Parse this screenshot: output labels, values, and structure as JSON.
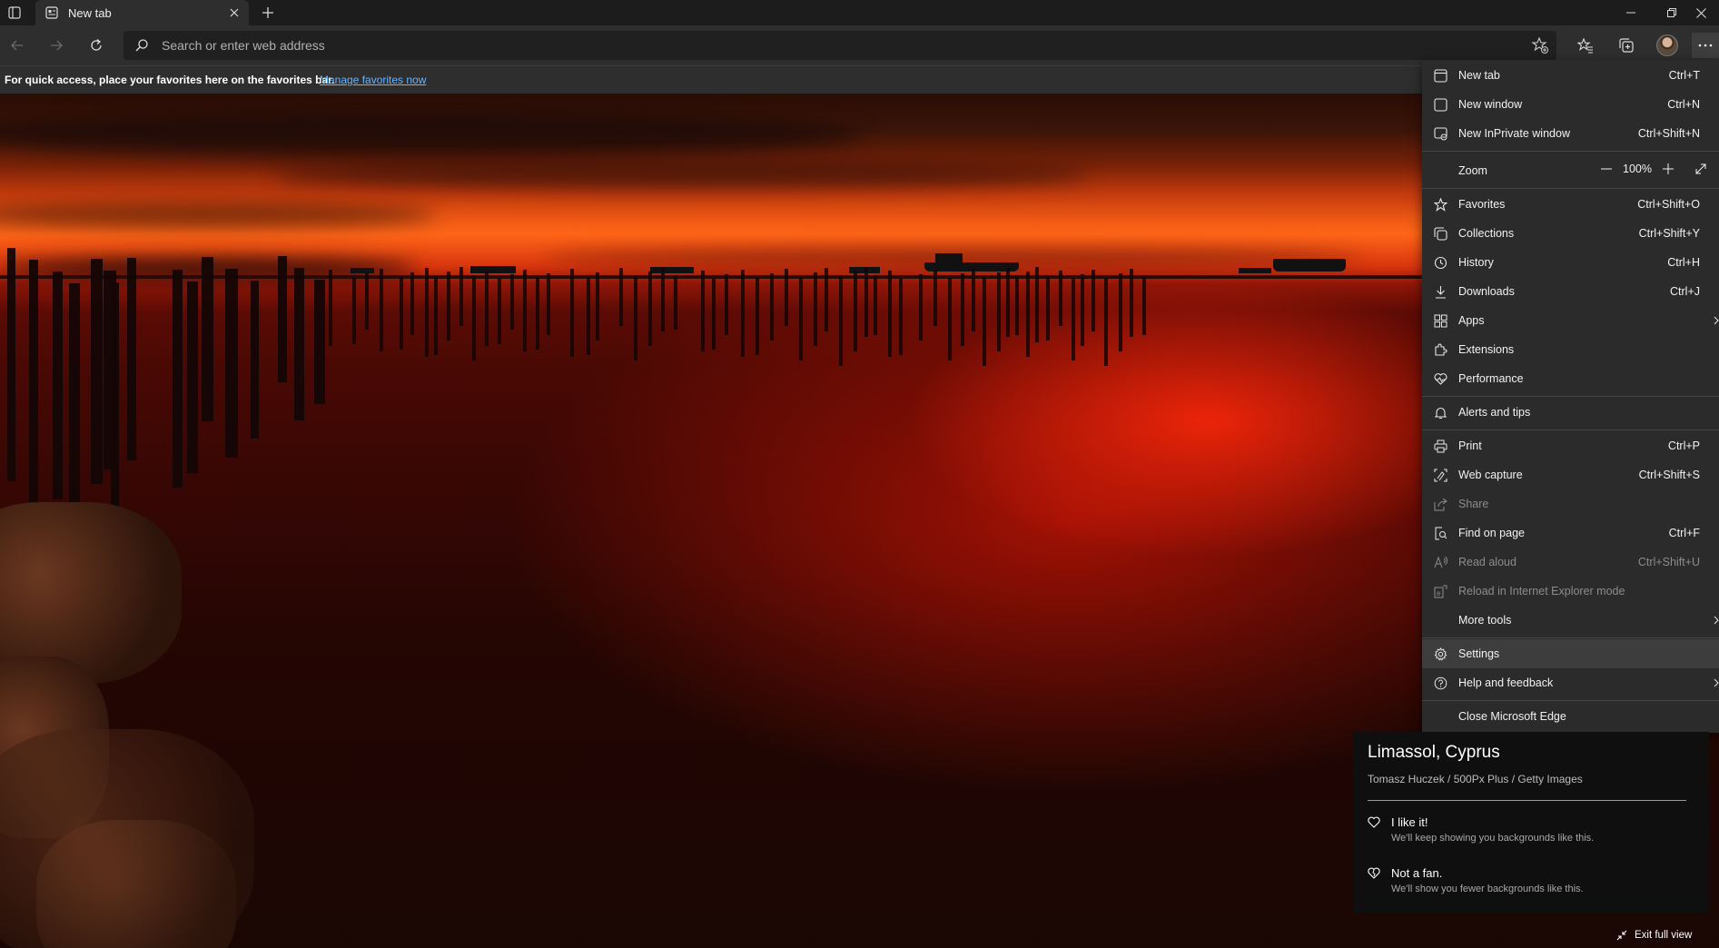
{
  "tab": {
    "title": "New tab"
  },
  "address": {
    "placeholder": "Search or enter web address"
  },
  "favorites_bar": {
    "message": "For quick access, place your favorites here on the favorites bar.",
    "link": "Manage favorites now"
  },
  "menu": {
    "items": [
      {
        "label": "New tab",
        "shortcut": "Ctrl+T",
        "icon": "new-tab-icon"
      },
      {
        "label": "New window",
        "shortcut": "Ctrl+N",
        "icon": "new-window-icon"
      },
      {
        "label": "New InPrivate window",
        "shortcut": "Ctrl+Shift+N",
        "icon": "inprivate-icon"
      },
      {
        "label": "Zoom",
        "value": "100%"
      },
      {
        "label": "Favorites",
        "shortcut": "Ctrl+Shift+O",
        "icon": "favorites-icon"
      },
      {
        "label": "Collections",
        "shortcut": "Ctrl+Shift+Y",
        "icon": "collections-icon"
      },
      {
        "label": "History",
        "shortcut": "Ctrl+H",
        "icon": "history-icon"
      },
      {
        "label": "Downloads",
        "shortcut": "Ctrl+J",
        "icon": "downloads-icon"
      },
      {
        "label": "Apps",
        "shortcut": "",
        "icon": "apps-icon"
      },
      {
        "label": "Extensions",
        "shortcut": "",
        "icon": "extensions-icon"
      },
      {
        "label": "Performance",
        "shortcut": "",
        "icon": "performance-icon"
      },
      {
        "label": "Alerts and tips",
        "shortcut": "",
        "icon": "bell-icon"
      },
      {
        "label": "Print",
        "shortcut": "Ctrl+P",
        "icon": "print-icon"
      },
      {
        "label": "Web capture",
        "shortcut": "Ctrl+Shift+S",
        "icon": "web-capture-icon"
      },
      {
        "label": "Share",
        "shortcut": "",
        "icon": "share-icon"
      },
      {
        "label": "Find on page",
        "shortcut": "Ctrl+F",
        "icon": "find-icon"
      },
      {
        "label": "Read aloud",
        "shortcut": "Ctrl+Shift+U",
        "icon": "read-aloud-icon"
      },
      {
        "label": "Reload in Internet Explorer mode",
        "shortcut": "",
        "icon": "ie-mode-icon"
      },
      {
        "label": "More tools",
        "shortcut": ""
      },
      {
        "label": "Settings",
        "shortcut": "",
        "icon": "gear-icon"
      },
      {
        "label": "Help and feedback",
        "shortcut": "",
        "icon": "help-icon"
      },
      {
        "label": "Close Microsoft Edge",
        "shortcut": ""
      }
    ]
  },
  "card": {
    "location": "Limassol, Cyprus",
    "credit": "Tomasz Huczek / 500Px Plus / Getty Images",
    "like_title": "I like it!",
    "like_desc": "We'll keep showing you backgrounds like this.",
    "dislike_title": "Not a fan.",
    "dislike_desc": "We'll show you fewer backgrounds like this."
  },
  "exit_full_view": "Exit full view"
}
